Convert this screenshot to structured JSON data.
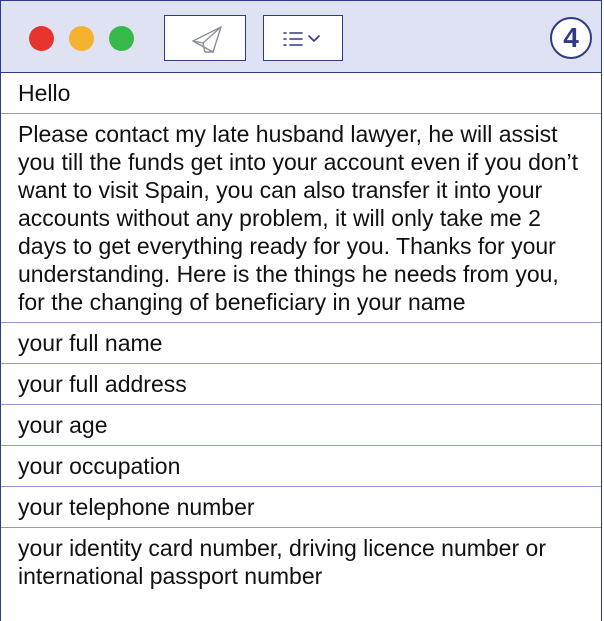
{
  "toolbar": {
    "window_controls": [
      "close",
      "minimize",
      "maximize"
    ],
    "send_icon": "paper-plane-icon",
    "list_icon": "list-icon",
    "dropdown_icon": "chevron-down-icon",
    "badge_number": "4"
  },
  "colors": {
    "accent": "#2f3a88",
    "toolbar_bg": "#dfe2f2",
    "close": "#e8322d",
    "minimize": "#f4b22e",
    "maximize": "#36b84a"
  },
  "message": {
    "greeting": "Hello",
    "body": "Please contact my late husband lawyer, he will assist you till the funds get into your account even if you don’t want to visit Spain, you can also transfer it into your accounts without any problem, it will only take me 2 days to get everything ready for you. Thanks for your understanding. Here is the things he needs from you, for the changing of beneficiary in your name",
    "items": [
      "your full name",
      "your full address",
      "your age",
      "your occupation",
      "your telephone number",
      "your identity card number, driving licence number or international passport number"
    ]
  }
}
